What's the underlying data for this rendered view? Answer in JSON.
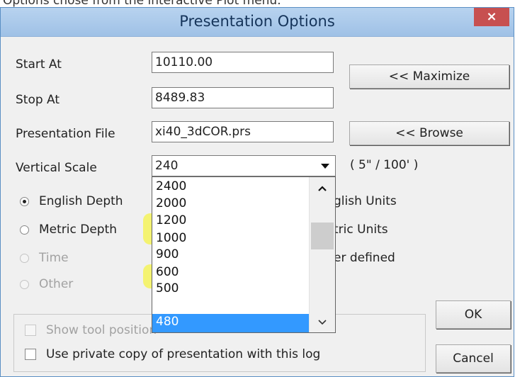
{
  "caption": "Options chose from the interactive Plot menu.",
  "dialog": {
    "title": "Presentation Options",
    "close_label": "×"
  },
  "fields": {
    "start_label": "Start At",
    "start_value": "10110.00",
    "stop_label": "Stop At",
    "stop_value": "8489.83",
    "file_label": "Presentation File",
    "file_value": "xi40_3dCOR.prs",
    "scale_label": "Vertical Scale",
    "scale_value": "240",
    "scale_note": "( 5\" / 100' )"
  },
  "buttons": {
    "maximize": "<< Maximize",
    "browse": "<< Browse",
    "ok": "OK",
    "cancel": "Cancel"
  },
  "depth_options": [
    {
      "label": "English Depth",
      "checked": true,
      "enabled": true
    },
    {
      "label": "Metric Depth",
      "checked": false,
      "enabled": true
    },
    {
      "label": "Time",
      "checked": false,
      "enabled": false
    },
    {
      "label": "Other",
      "checked": false,
      "enabled": false
    }
  ],
  "unit_options": [
    {
      "label_visible": "glish Units"
    },
    {
      "label_visible": "tric Units"
    },
    {
      "label_visible": "er defined"
    }
  ],
  "scale_list": {
    "items": [
      "2400",
      "2000",
      "1200",
      "1000",
      "900",
      "600",
      "500",
      "480"
    ],
    "selected": "480",
    "highlighted_by_marker": [
      "1200",
      "1000",
      "600"
    ]
  },
  "checkboxes": {
    "show_tool_position": "Show tool position",
    "private_copy": "Use private copy of presentation with this log"
  },
  "colors": {
    "selection": "#3399ff",
    "highlighter": "#f4f35a",
    "title_bar": "#b8d3ef",
    "close_button": "#c75050"
  }
}
